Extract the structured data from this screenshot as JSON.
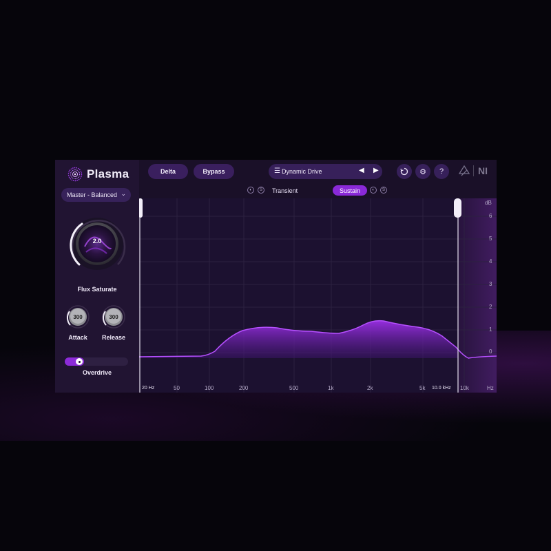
{
  "app": {
    "name": "Plasma",
    "accent": "#8a29d8",
    "brand_ni": "NI"
  },
  "left_panel": {
    "preset_select": "Master - Balanced",
    "main_knob": {
      "label": "Flux Saturate",
      "value": "2.0"
    },
    "attack": {
      "label": "Attack",
      "value": "300"
    },
    "release": {
      "label": "Release",
      "value": "300"
    },
    "overdrive": {
      "label": "Overdrive",
      "on": true
    }
  },
  "header": {
    "delta_label": "Delta",
    "bypass_label": "Bypass",
    "preset_name": "Dynamic Drive",
    "mode_left": "Transient",
    "mode_right": "Sustain",
    "solo_letter": "S"
  },
  "graph": {
    "db_axis_title": "dB",
    "db_ticks": [
      "6",
      "5",
      "4",
      "3",
      "2",
      "1",
      "0"
    ],
    "hz_ticks": [
      "20 Hz",
      "50",
      "100",
      "200",
      "500",
      "1k",
      "2k",
      "5k",
      "10.0 kHz",
      "10k",
      "Hz"
    ],
    "low_cut": "20 Hz",
    "high_cut": "10.0 kHz"
  }
}
